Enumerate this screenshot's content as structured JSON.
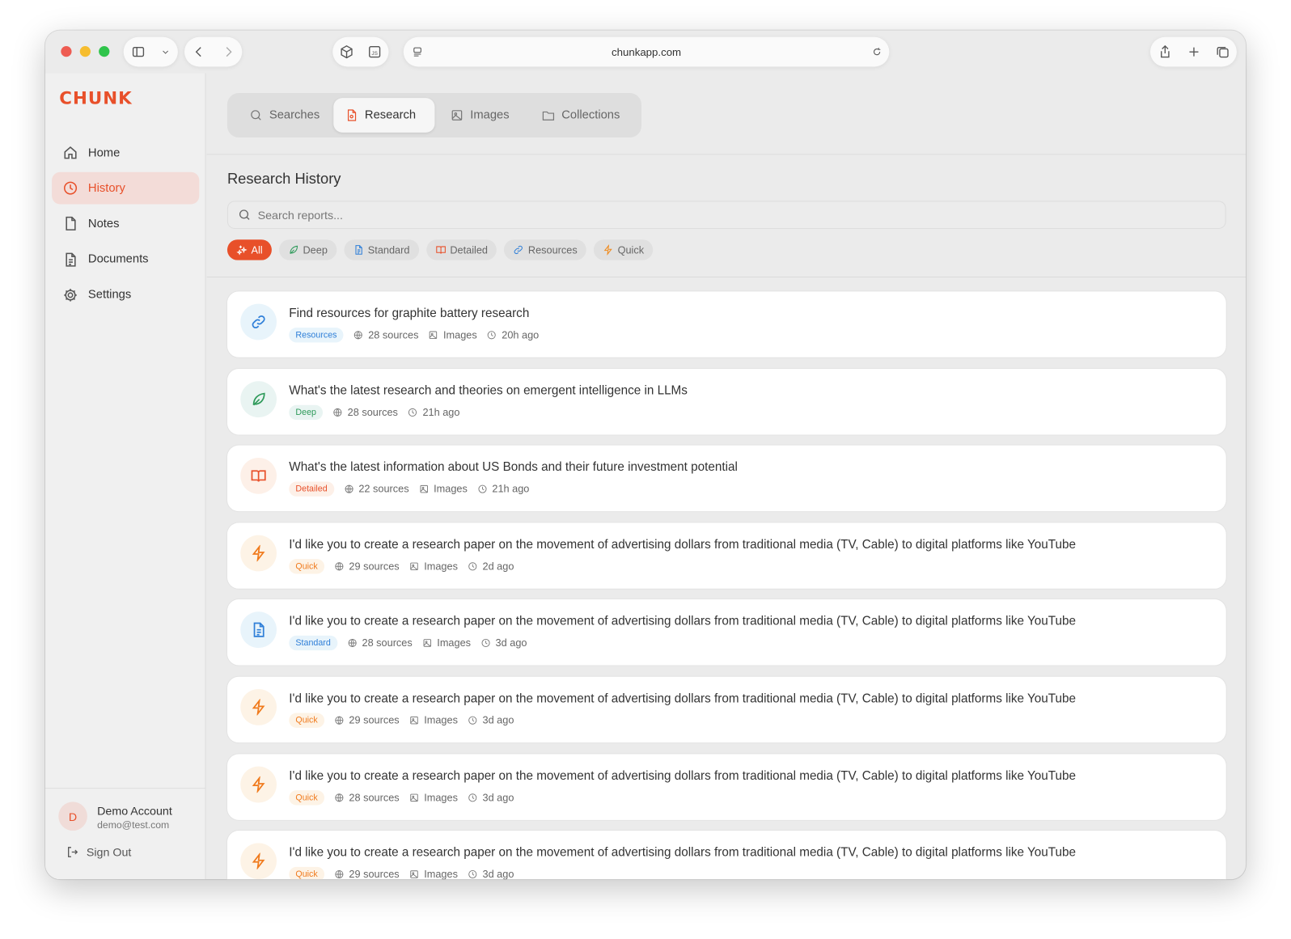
{
  "browser": {
    "url": "chunkapp.com"
  },
  "app": {
    "logo": "CHUNK",
    "accent": "#e8502a"
  },
  "sidebar": {
    "items": [
      {
        "label": "Home",
        "icon": "home-icon"
      },
      {
        "label": "History",
        "icon": "clock-icon",
        "active": true
      },
      {
        "label": "Notes",
        "icon": "file-icon"
      },
      {
        "label": "Documents",
        "icon": "document-icon"
      },
      {
        "label": "Settings",
        "icon": "gear-icon"
      }
    ],
    "account": {
      "initial": "D",
      "name": "Demo Account",
      "email": "demo@test.com"
    },
    "sign_out": "Sign Out"
  },
  "tabs": [
    {
      "label": "Searches",
      "icon": "search-icon"
    },
    {
      "label": "Research",
      "icon": "report-icon",
      "active": true
    },
    {
      "label": "Images",
      "icon": "image-icon"
    },
    {
      "label": "Collections",
      "icon": "folder-icon"
    }
  ],
  "main": {
    "title": "Research History",
    "search_placeholder": "Search reports...",
    "filters": [
      {
        "label": "All",
        "icon": "sparkles-icon",
        "active": true,
        "color": "#ffffff"
      },
      {
        "label": "Deep",
        "icon": "leaf-icon",
        "color": "#2e9a5a"
      },
      {
        "label": "Standard",
        "icon": "document-icon",
        "color": "#2f7fd8"
      },
      {
        "label": "Detailed",
        "icon": "book-icon",
        "color": "#e8502a"
      },
      {
        "label": "Resources",
        "icon": "link-icon",
        "color": "#2f7fd8"
      },
      {
        "label": "Quick",
        "icon": "bolt-icon",
        "color": "#f08a1c"
      }
    ]
  },
  "types": {
    "Resources": {
      "icon": "link-icon",
      "color": "#2f7fd8",
      "bg": "#e8f4fb"
    },
    "Deep": {
      "icon": "leaf-icon",
      "color": "#2e9a5a",
      "bg": "#e9f4f2"
    },
    "Detailed": {
      "icon": "book-icon",
      "color": "#e8502a",
      "bg": "#fdf0e8"
    },
    "Quick": {
      "icon": "bolt-icon",
      "color": "#f07a1c",
      "bg": "#fdf3e6"
    },
    "Standard": {
      "icon": "document-icon",
      "color": "#2f7fd8",
      "bg": "#e8f4fb"
    }
  },
  "reports": [
    {
      "title": "Find resources for graphite battery research",
      "type": "Resources",
      "sources": "28 sources",
      "images": "Images",
      "time": "20h ago"
    },
    {
      "title": "What's the latest research and theories on emergent intelligence in LLMs",
      "type": "Deep",
      "sources": "28 sources",
      "time": "21h ago"
    },
    {
      "title": "What's the latest information about US Bonds and their future investment potential",
      "type": "Detailed",
      "sources": "22 sources",
      "images": "Images",
      "time": "21h ago"
    },
    {
      "title": "I'd like you to create a research paper on the movement of advertising dollars from traditional media (TV, Cable) to digital platforms like YouTube",
      "type": "Quick",
      "sources": "29 sources",
      "images": "Images",
      "time": "2d ago"
    },
    {
      "title": "I'd like you to create a research paper on the movement of advertising dollars from traditional media (TV, Cable) to digital platforms like YouTube",
      "type": "Standard",
      "sources": "28 sources",
      "images": "Images",
      "time": "3d ago"
    },
    {
      "title": "I'd like you to create a research paper on the movement of advertising dollars from traditional media (TV, Cable) to digital platforms like YouTube",
      "type": "Quick",
      "sources": "29 sources",
      "images": "Images",
      "time": "3d ago"
    },
    {
      "title": "I'd like you to create a research paper on the movement of advertising dollars from traditional media (TV, Cable) to digital platforms like YouTube",
      "type": "Quick",
      "sources": "28 sources",
      "images": "Images",
      "time": "3d ago"
    },
    {
      "title": "I'd like you to create a research paper on the movement of advertising dollars from traditional media (TV, Cable) to digital platforms like YouTube",
      "type": "Quick",
      "sources": "29 sources",
      "images": "Images",
      "time": "3d ago"
    }
  ]
}
